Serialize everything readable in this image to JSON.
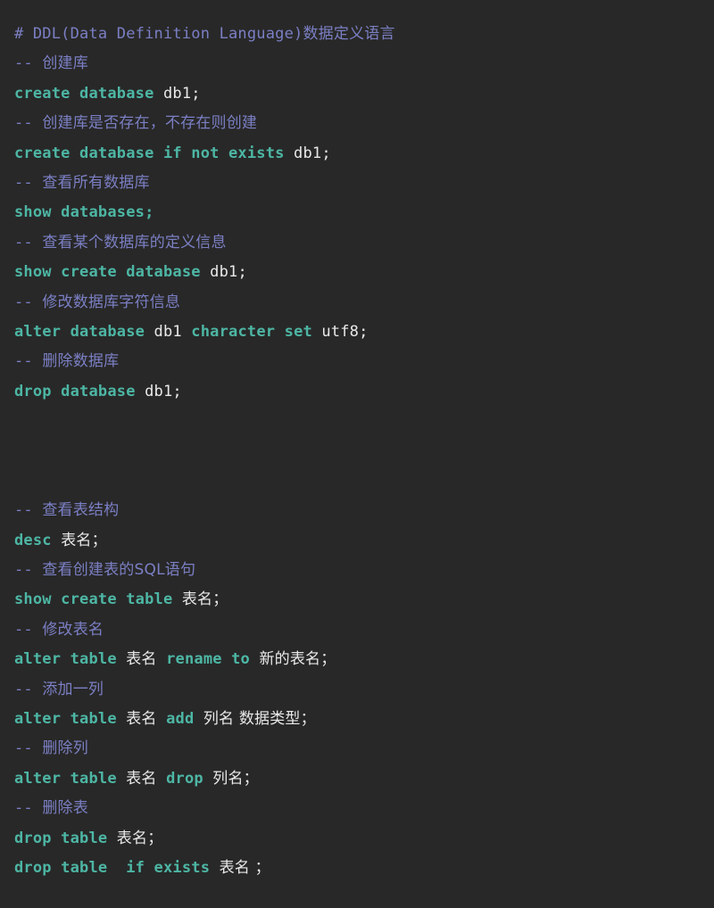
{
  "editor": {
    "background_color": "#282828",
    "keyword_color": "#4db6a4",
    "comment_color": "#7b7fc4",
    "identifier_color": "#e9e9e9",
    "language": "sql",
    "title_line": "# DDL(Data Definition Language)数据定义语言"
  },
  "lines": [
    {
      "id": "line-1",
      "type": "comment",
      "text": "# DDL(Data Definition Language)数据定义语言",
      "tokens": [
        {
          "k": "cmt",
          "t": "# DDL(Data Definition Language)"
        },
        {
          "k": "cmt-han",
          "t": "数据定义语言"
        }
      ]
    },
    {
      "id": "line-2",
      "type": "comment",
      "text": "-- 创建库",
      "tokens": [
        {
          "k": "cmt",
          "t": "-- "
        },
        {
          "k": "cmt-han",
          "t": "创建库"
        }
      ]
    },
    {
      "id": "line-3",
      "type": "statement",
      "text": "create database db1;",
      "tokens": [
        {
          "k": "kw",
          "t": "create database"
        },
        {
          "k": "id",
          "t": " db1;"
        }
      ]
    },
    {
      "id": "line-4",
      "type": "comment",
      "text": "-- 创建库是否存在，不存在则创建",
      "tokens": [
        {
          "k": "cmt",
          "t": "-- "
        },
        {
          "k": "cmt-han",
          "t": "创建库是否存在，不存在则创建"
        }
      ]
    },
    {
      "id": "line-5",
      "type": "statement",
      "text": "create database if not exists db1;",
      "tokens": [
        {
          "k": "kw",
          "t": "create database if not exists"
        },
        {
          "k": "id",
          "t": " db1;"
        }
      ]
    },
    {
      "id": "line-6",
      "type": "comment",
      "text": "-- 查看所有数据库",
      "tokens": [
        {
          "k": "cmt",
          "t": "-- "
        },
        {
          "k": "cmt-han",
          "t": "查看所有数据库"
        }
      ]
    },
    {
      "id": "line-7",
      "type": "statement",
      "text": "show databases;",
      "tokens": [
        {
          "k": "kw",
          "t": "show databases;"
        }
      ]
    },
    {
      "id": "line-8",
      "type": "comment",
      "text": "-- 查看某个数据库的定义信息",
      "tokens": [
        {
          "k": "cmt",
          "t": "-- "
        },
        {
          "k": "cmt-han",
          "t": "查看某个数据库的定义信息"
        }
      ]
    },
    {
      "id": "line-9",
      "type": "statement",
      "text": "show create database db1;",
      "tokens": [
        {
          "k": "kw",
          "t": "show create database"
        },
        {
          "k": "id",
          "t": " db1;"
        }
      ]
    },
    {
      "id": "line-10",
      "type": "comment",
      "text": "-- 修改数据库字符信息",
      "tokens": [
        {
          "k": "cmt",
          "t": "-- "
        },
        {
          "k": "cmt-han",
          "t": "修改数据库字符信息"
        }
      ]
    },
    {
      "id": "line-11",
      "type": "statement",
      "text": "alter database db1 character set utf8;",
      "tokens": [
        {
          "k": "kw",
          "t": "alter database"
        },
        {
          "k": "id",
          "t": " db1 "
        },
        {
          "k": "kw",
          "t": "character set"
        },
        {
          "k": "id",
          "t": " utf8;"
        }
      ]
    },
    {
      "id": "line-12",
      "type": "comment",
      "text": "-- 删除数据库",
      "tokens": [
        {
          "k": "cmt",
          "t": "-- "
        },
        {
          "k": "cmt-han",
          "t": "删除数据库"
        }
      ]
    },
    {
      "id": "line-13",
      "type": "statement",
      "text": "drop database db1;",
      "tokens": [
        {
          "k": "kw",
          "t": "drop database"
        },
        {
          "k": "id",
          "t": " db1;"
        }
      ]
    },
    {
      "id": "line-14",
      "type": "blank",
      "text": "",
      "tokens": []
    },
    {
      "id": "line-15",
      "type": "blank",
      "text": "",
      "tokens": []
    },
    {
      "id": "line-16",
      "type": "blank",
      "text": "",
      "tokens": []
    },
    {
      "id": "line-17",
      "type": "comment",
      "text": "-- 查看表结构",
      "tokens": [
        {
          "k": "cmt",
          "t": "-- "
        },
        {
          "k": "cmt-han",
          "t": "查看表结构"
        }
      ]
    },
    {
      "id": "line-18",
      "type": "statement",
      "text": "desc 表名；",
      "tokens": [
        {
          "k": "kw",
          "t": "desc"
        },
        {
          "k": "id",
          "t": " "
        },
        {
          "k": "han",
          "t": "表名；"
        }
      ]
    },
    {
      "id": "line-19",
      "type": "comment",
      "text": "-- 查看创建表的SQL语句",
      "tokens": [
        {
          "k": "cmt",
          "t": "-- "
        },
        {
          "k": "cmt-han",
          "t": "查看创建表的SQL语句"
        }
      ]
    },
    {
      "id": "line-20",
      "type": "statement",
      "text": "show create table 表名；",
      "tokens": [
        {
          "k": "kw",
          "t": "show create table"
        },
        {
          "k": "id",
          "t": " "
        },
        {
          "k": "han",
          "t": "表名；"
        }
      ]
    },
    {
      "id": "line-21",
      "type": "comment",
      "text": "-- 修改表名",
      "tokens": [
        {
          "k": "cmt",
          "t": "-- "
        },
        {
          "k": "cmt-han",
          "t": "修改表名"
        }
      ]
    },
    {
      "id": "line-22",
      "type": "statement",
      "text": "alter table 表名 rename to 新的表名；",
      "tokens": [
        {
          "k": "kw",
          "t": "alter table"
        },
        {
          "k": "id",
          "t": " "
        },
        {
          "k": "han",
          "t": "表名"
        },
        {
          "k": "id",
          "t": " "
        },
        {
          "k": "kw",
          "t": "rename to"
        },
        {
          "k": "id",
          "t": " "
        },
        {
          "k": "han",
          "t": "新的表名；"
        }
      ]
    },
    {
      "id": "line-23",
      "type": "comment",
      "text": "-- 添加一列",
      "tokens": [
        {
          "k": "cmt",
          "t": "-- "
        },
        {
          "k": "cmt-han",
          "t": "添加一列"
        }
      ]
    },
    {
      "id": "line-24",
      "type": "statement",
      "text": "alter table 表名 add 列名 数据类型；",
      "tokens": [
        {
          "k": "kw",
          "t": "alter table"
        },
        {
          "k": "id",
          "t": " "
        },
        {
          "k": "han",
          "t": "表名"
        },
        {
          "k": "id",
          "t": " "
        },
        {
          "k": "kw",
          "t": "add"
        },
        {
          "k": "id",
          "t": " "
        },
        {
          "k": "han",
          "t": "列名 数据类型；"
        }
      ]
    },
    {
      "id": "line-25",
      "type": "comment",
      "text": "-- 删除列",
      "tokens": [
        {
          "k": "cmt",
          "t": "-- "
        },
        {
          "k": "cmt-han",
          "t": "删除列"
        }
      ]
    },
    {
      "id": "line-26",
      "type": "statement",
      "text": "alter table 表名 drop 列名；",
      "tokens": [
        {
          "k": "kw",
          "t": "alter table"
        },
        {
          "k": "id",
          "t": " "
        },
        {
          "k": "han",
          "t": "表名"
        },
        {
          "k": "id",
          "t": " "
        },
        {
          "k": "kw",
          "t": "drop"
        },
        {
          "k": "id",
          "t": " "
        },
        {
          "k": "han",
          "t": "列名；"
        }
      ]
    },
    {
      "id": "line-27",
      "type": "comment",
      "text": "-- 删除表",
      "tokens": [
        {
          "k": "cmt",
          "t": "-- "
        },
        {
          "k": "cmt-han",
          "t": "删除表"
        }
      ]
    },
    {
      "id": "line-28",
      "type": "statement",
      "text": "drop table 表名；",
      "tokens": [
        {
          "k": "kw",
          "t": "drop table"
        },
        {
          "k": "id",
          "t": " "
        },
        {
          "k": "han",
          "t": "表名；"
        }
      ]
    },
    {
      "id": "line-29",
      "type": "statement",
      "text": "drop table  if exists 表名 ；",
      "tokens": [
        {
          "k": "kw",
          "t": "drop table  if exists"
        },
        {
          "k": "id",
          "t": " "
        },
        {
          "k": "han",
          "t": "表名 ；"
        }
      ]
    }
  ]
}
